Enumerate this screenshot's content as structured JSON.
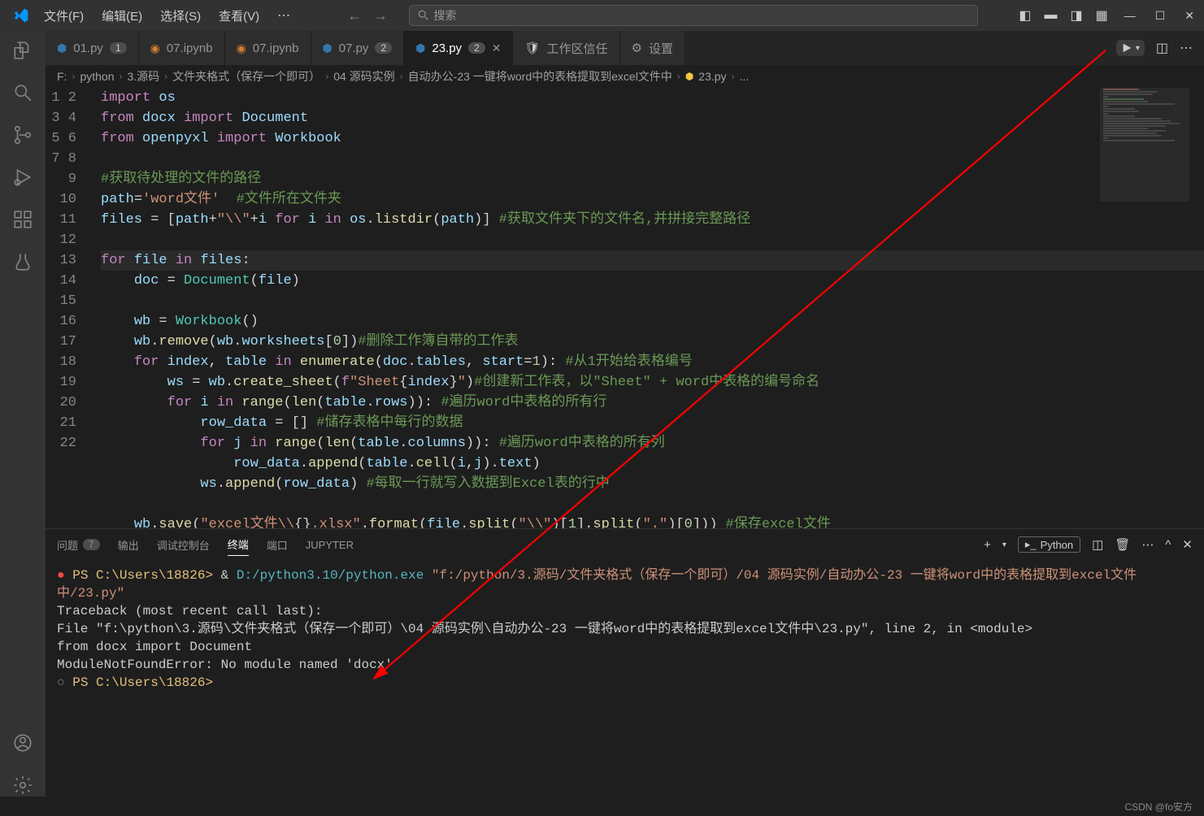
{
  "menu": {
    "file": "文件(F)",
    "edit": "编辑(E)",
    "select": "选择(S)",
    "view": "查看(V)"
  },
  "search": {
    "placeholder": "搜索"
  },
  "tabs": [
    {
      "name": "01.py",
      "icon": "py",
      "badge": "1"
    },
    {
      "name": "07.ipynb",
      "icon": "jup"
    },
    {
      "name": "07.ipynb",
      "icon": "jup"
    },
    {
      "name": "07.py",
      "icon": "py",
      "badge": "2"
    },
    {
      "name": "23.py",
      "icon": "py",
      "badge": "2",
      "active": true,
      "close": true
    },
    {
      "name": "工作区信任",
      "icon": "shield"
    },
    {
      "name": "设置",
      "icon": "gear"
    }
  ],
  "breadcrumb": {
    "parts": [
      "F:",
      "python",
      "3.源码",
      "文件夹格式（保存一个即可）",
      "04 源码实例",
      "自动办公-23 一键将word中的表格提取到excel文件中"
    ],
    "file": "23.py",
    "more": "..."
  },
  "code": {
    "lines": 22
  },
  "panel": {
    "tabs": {
      "problems": "问题",
      "problems_count": "7",
      "output": "输出",
      "debug": "调试控制台",
      "terminal": "终端",
      "ports": "端口",
      "jupyter": "JUPYTER"
    },
    "python_label": "Python"
  },
  "terminal": {
    "prompt1": "PS C:\\Users\\18826> ",
    "amp": "& ",
    "exe": "D:/python3.10/python.exe",
    "script": "\"f:/python/3.源码/文件夹格式（保存一个即可）/04 源码实例/自动办公-23 一键将word中的表格提取到excel文件中/23.py\"",
    "trace1": "Traceback (most recent call last):",
    "trace2": "  File \"f:\\python\\3.源码\\文件夹格式（保存一个即可）\\04 源码实例\\自动办公-23 一键将word中的表格提取到excel文件中\\23.py\", line 2, in <module>",
    "trace3": "    from docx import Document",
    "error": "ModuleNotFoundError: No module named 'docx'",
    "prompt2": "PS C:\\Users\\18826>"
  },
  "watermark": "CSDN @fo安方"
}
